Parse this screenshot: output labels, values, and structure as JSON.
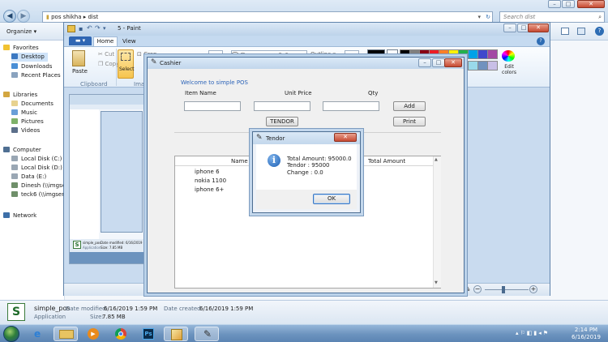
{
  "explorer": {
    "breadcrumb": [
      "pos shikha",
      "dist"
    ],
    "search_placeholder": "Search dist",
    "organize_label": "Organize ▾",
    "nav": {
      "favorites_label": "Favorites",
      "favorites": [
        "Desktop",
        "Downloads",
        "Recent Places"
      ],
      "libraries_label": "Libraries",
      "libraries": [
        "Documents",
        "Music",
        "Pictures",
        "Videos"
      ],
      "computer_label": "Computer",
      "drives": [
        "Local Disk (C:)",
        "Local Disk (D:)",
        "Data (E:)",
        "Dinesh (\\\\imgser",
        "teck6 (\\\\imgserve"
      ],
      "network_label": "Network"
    },
    "details": {
      "name": "simple_pos",
      "type": "Application",
      "modified_label": "Date modified:",
      "modified_value": "6/16/2019 1:59 PM",
      "created_label": "Date created:",
      "created_value": "6/16/2019 1:59 PM",
      "size_label": "Size:",
      "size_value": "7.85 MB"
    }
  },
  "paint": {
    "title": "5 - Paint",
    "tabs": [
      "Home",
      "View"
    ],
    "clipboard": {
      "paste": "Paste",
      "cut": "Cut",
      "copy": "Copy",
      "group": "Clipboard"
    },
    "image": {
      "select": "Select",
      "crop": "Crop",
      "group": "Image"
    },
    "outline": "Outline ▾",
    "edit_colors": "Edit colors",
    "zoom": "%",
    "palette": [
      "#000000",
      "#7f7f7f",
      "#880015",
      "#ed1c24",
      "#ff7f27",
      "#fff200",
      "#22b14c",
      "#00a2e8",
      "#3f48cc",
      "#a349a4",
      "#ffffff",
      "#c3c3c3",
      "#b97a57",
      "#ffaec9",
      "#ffc90e",
      "#efe4b0",
      "#b5e61d",
      "#99d9ea",
      "#7092be",
      "#c8bfe7"
    ],
    "thumb_caption": {
      "name": "simple_pos",
      "type": "Application",
      "meta": "Date modified: 6/16/2019 1:59 PM",
      "size": "Size: 7.85 MB"
    }
  },
  "cashier": {
    "title": "Cashier",
    "welcome": "Welcome to simple POS",
    "labels": {
      "item_name": "Item Name",
      "unit_price": "Unit Price",
      "qty": "Qty"
    },
    "buttons": {
      "add": "Add",
      "print": "Print",
      "tendor": "TENDOR"
    },
    "table": {
      "columns": [
        "Name",
        "Total Amount"
      ],
      "rows": [
        "iphone 6",
        "nokia 1100",
        "iphone 6+"
      ]
    }
  },
  "tendor": {
    "title": "Tendor",
    "lines": [
      "Total Amount: 95000.0",
      "Tendor : 95000",
      "Change : 0.0"
    ],
    "ok": "OK"
  },
  "taskbar": {
    "time": "2:14 PM",
    "date": "6/16/2019"
  }
}
